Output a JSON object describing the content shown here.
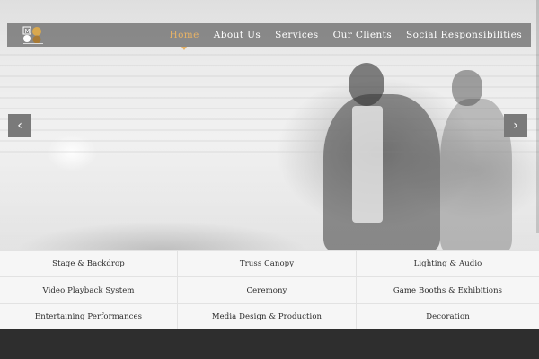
{
  "header": {
    "nav": [
      {
        "label": "Home",
        "active": true
      },
      {
        "label": "About Us",
        "active": false
      },
      {
        "label": "Services",
        "active": false
      },
      {
        "label": "Our Clients",
        "active": false
      },
      {
        "label": "Social Responsibilities",
        "active": false
      }
    ]
  },
  "slider": {
    "prev_icon": "chevron-left-icon",
    "next_icon": "chevron-right-icon"
  },
  "services": [
    "Stage & Backdrop",
    "Truss Canopy",
    "Lighting & Audio",
    "Video Playback System",
    "Ceremony",
    "Game Booths & Exhibitions",
    "Entertaining Performances",
    "Media Design & Production",
    "Decoration"
  ],
  "colors": {
    "accent": "#e6b266",
    "header_bg": "#787878",
    "footer_bg": "#2e2e2e",
    "grid_bg": "#f5f5f5"
  }
}
